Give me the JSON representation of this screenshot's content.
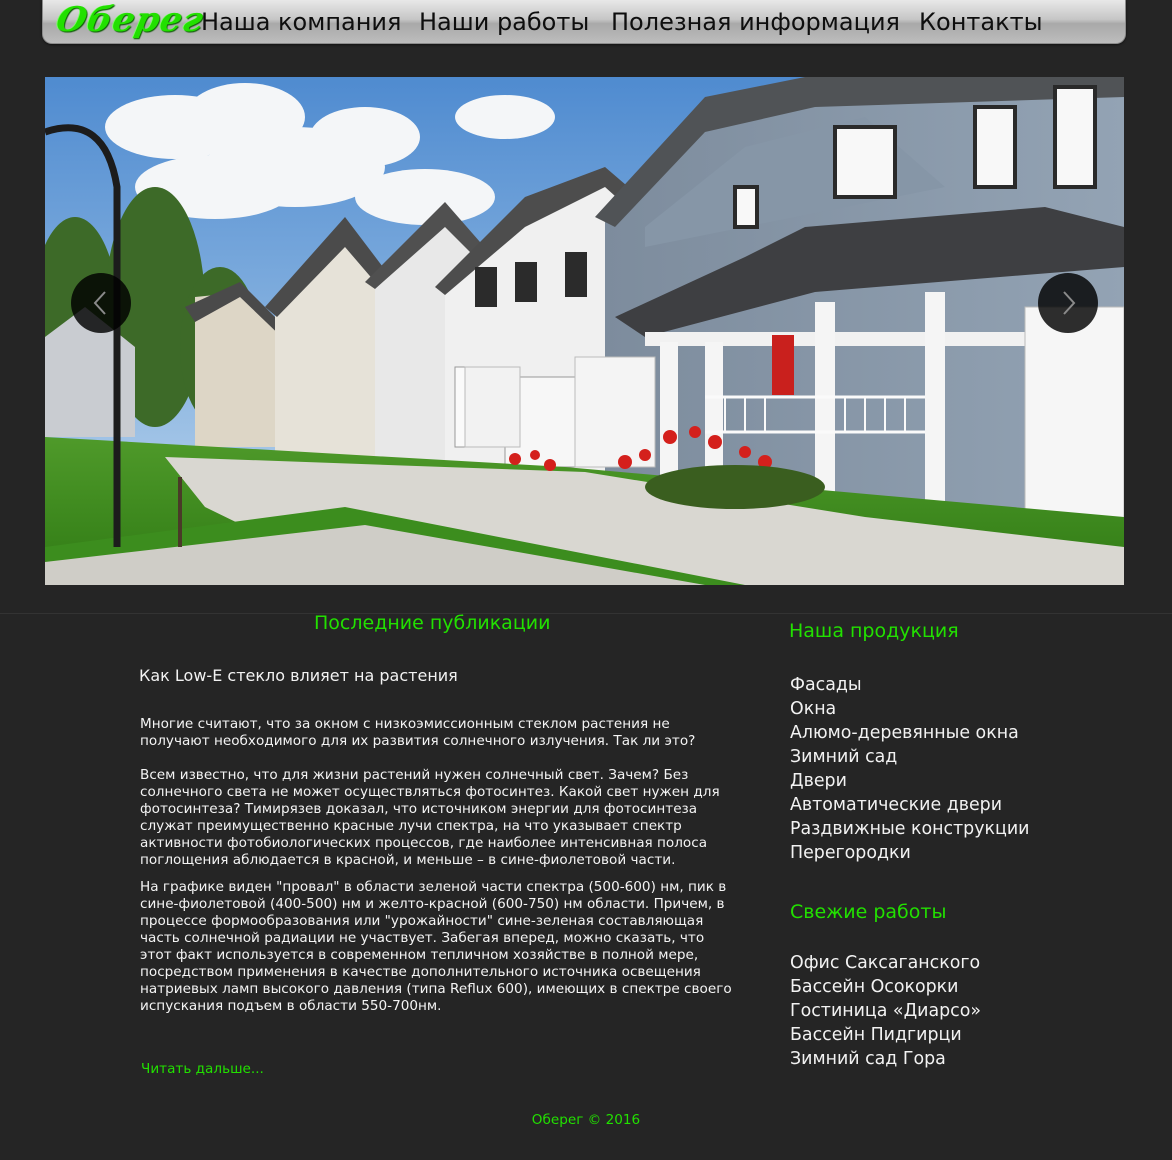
{
  "nav": {
    "logo": "Оберег",
    "items": [
      "Наша компания",
      "Наши работы",
      "Полезная информация",
      "Контакты"
    ]
  },
  "slider": {
    "image": "suburban-houses-photo",
    "prev_icon": "chevron-left-icon",
    "next_icon": "chevron-right-icon"
  },
  "publications": {
    "heading": "Последние публикации",
    "article_title": "Как Low-E стекло влияет на растения",
    "paragraphs": [
      "Многие считают, что за окном с низкоэмиссионным стеклом растения не получают необходимого для их развития солнечного излучения. Так ли это?",
      "Всем известно, что для жизни растений нужен солнечный свет. Зачем? Без солнечного света не может осуществляться фотосинтез. Какой свет нужен для фотосинтеза? Тимирязев доказал, что источником энергии для фотосинтеза служат преимущественно красные лучи спектра, на что указывает спектр активности фотобиологических процессов, где наиболее интенсивная полоса поглощения аблюдается в красной, и меньше – в сине-фиолетовой части.",
      "На графике виден \"провал\" в области зеленой части спектра (500-600) нм, пик в сине-фиолетовой (400-500) нм и желто-красной (600-750) нм области. Причем, в процессе формообразования или \"урожайности\" сине-зеленая составляющая часть солнечной радиации не участвует. Забегая вперед, можно сказать, что этот факт используется в современном тепличном хозяйстве в полной мере, посредством применения в качестве дополнительного источника освещения натриевых ламп высокого давления (типа Reflux 600), имеющих в спектре своего испускания подъем в области 550-700нм."
    ],
    "read_more": "Читать дальше..."
  },
  "products": {
    "heading": "Наша продукция",
    "items": [
      "Фасады",
      "Окна",
      "Алюмо-деревянные окна",
      "Зимний сад",
      "Двери",
      "Автоматические двери",
      "Раздвижные конструкции",
      "Перегородки"
    ]
  },
  "recent_works": {
    "heading": "Свежие работы",
    "items": [
      "Офис Саксаганского",
      "Бассейн Осокорки",
      "Гостиница «Диарсо»",
      "Бассейн Пидгирци",
      "Зимний сад Гора"
    ]
  },
  "footer": {
    "text": "Оберег © 2016"
  },
  "colors": {
    "accent": "#22e000",
    "background": "#252525",
    "text": "#f2f2f2"
  }
}
